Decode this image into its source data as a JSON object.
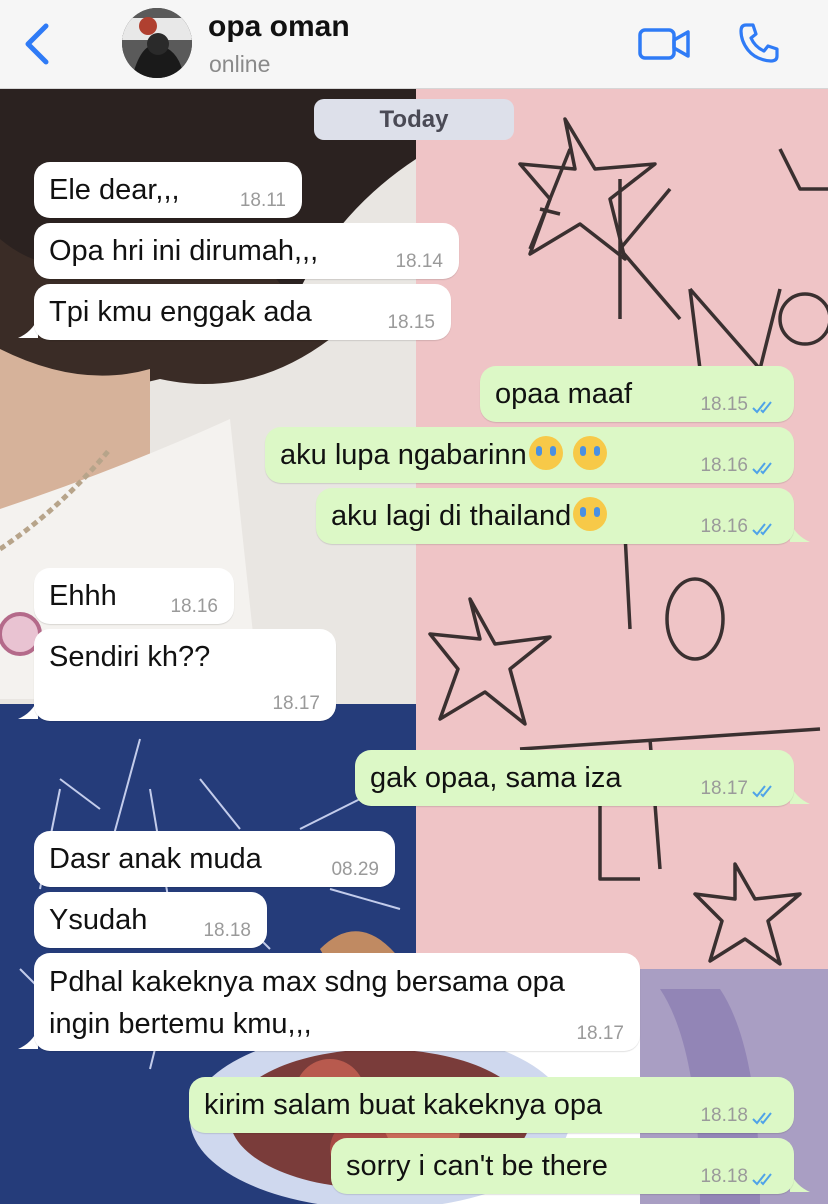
{
  "header": {
    "back_label": "<",
    "contact_name": "opa oman",
    "status": "online",
    "icons": [
      "chevron-left-icon",
      "video-camera-icon",
      "phone-icon"
    ],
    "accent_color": "#2f7bf6"
  },
  "date_separator": "Today",
  "messages": [
    {
      "dir": "in",
      "text": "Ele dear,,,",
      "time": "18.11"
    },
    {
      "dir": "in",
      "text": "Opa hri ini dirumah,,,",
      "time": "18.14"
    },
    {
      "dir": "in",
      "text": "Tpi kmu enggak ada",
      "time": "18.15"
    },
    {
      "dir": "out",
      "text": "opaa maaf",
      "time": "18.15",
      "read": true
    },
    {
      "dir": "out",
      "text": "aku lupa ngabarinn",
      "emoji": "loudly-crying-face x2",
      "time": "18.16",
      "read": true
    },
    {
      "dir": "out",
      "text": "aku lagi di thailand",
      "emoji": "loudly-crying-face",
      "time": "18.16",
      "read": true
    },
    {
      "dir": "in",
      "text": "Ehhh",
      "time": "18.16"
    },
    {
      "dir": "in",
      "text": "Sendiri kh??",
      "time": "18.17"
    },
    {
      "dir": "out",
      "text": "gak opaa, sama iza",
      "time": "18.17",
      "read": true
    },
    {
      "dir": "in",
      "text": "Dasr anak muda",
      "time": "08.29"
    },
    {
      "dir": "in",
      "text": "Ysudah",
      "time": "18.18"
    },
    {
      "dir": "in",
      "text": "Pdhal kakeknya max sdng bersama opa ingin bertemu kmu,,,",
      "time": "18.17"
    },
    {
      "dir": "out",
      "text": "kirim salam buat kakeknya opa",
      "time": "18.18",
      "read": true
    },
    {
      "dir": "out",
      "text": "sorry i can't be there",
      "time": "18.18",
      "read": true
    }
  ],
  "colors": {
    "incoming_bubble": "#ffffff",
    "outgoing_bubble": "#dcf8c6",
    "read_ticks": "#4fa3e8"
  }
}
